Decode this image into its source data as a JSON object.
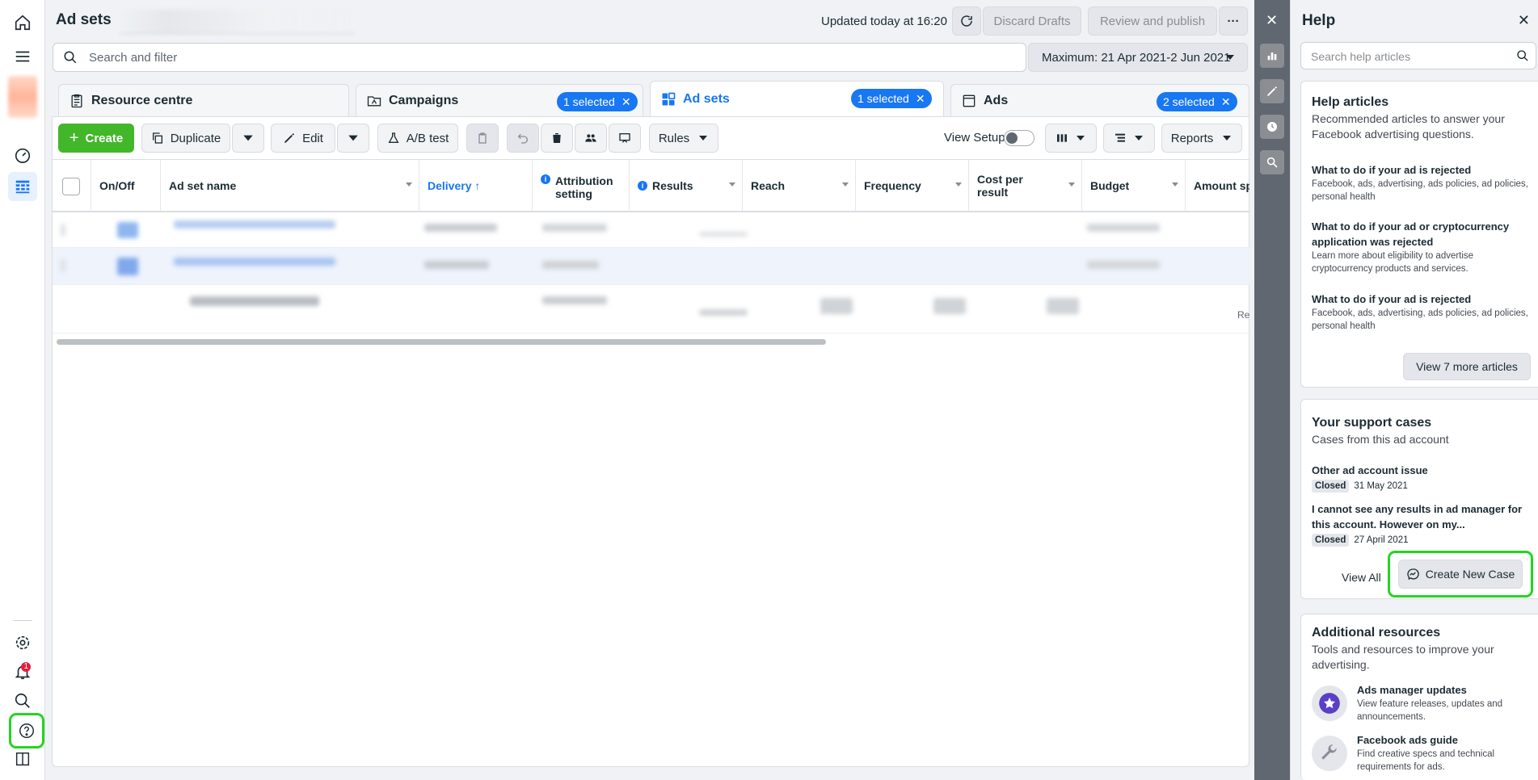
{
  "page": {
    "title": "Ad sets",
    "updated": "Updated today at 16:20"
  },
  "header": {
    "discard": "Discard Drafts",
    "review": "Review and publish",
    "more": "···"
  },
  "search": {
    "placeholder": "Search and filter"
  },
  "date_range": "Maximum: 21 Apr 2021-2 Jun 2021",
  "tabs": [
    {
      "label": "Resource centre"
    },
    {
      "label": "Campaigns",
      "selected": "1 selected"
    },
    {
      "label": "Ad sets",
      "selected": "1 selected"
    },
    {
      "label": "Ads",
      "selected": "2 selected"
    }
  ],
  "toolbar": {
    "create": "Create",
    "duplicate": "Duplicate",
    "edit": "Edit",
    "ab_test": "A/B test",
    "rules": "Rules",
    "view_setup": "View Setup",
    "reports": "Reports"
  },
  "columns": [
    "On/Off",
    "Ad set name",
    "Delivery ↑",
    "Attribution setting",
    "Results",
    "Reach",
    "Frequency",
    "Cost per result",
    "Budget",
    "Amount spe"
  ],
  "row_fragment": "Re",
  "help": {
    "title": "Help",
    "search_placeholder": "Search help articles",
    "articles_title": "Help articles",
    "articles_sub": "Recommended articles to answer your Facebook advertising questions.",
    "articles": [
      {
        "title": "What to do if your ad is rejected",
        "desc": "Facebook, ads, advertising, ads policies, ad policies, personal health"
      },
      {
        "title": "What to do if your ad or cryptocurrency application was rejected",
        "desc": "Learn more about eligibility to advertise cryptocurrency products and services."
      },
      {
        "title": "What to do if your ad is rejected",
        "desc": "Facebook, ads, advertising, ads policies, ad policies, personal health"
      }
    ],
    "view_more": "View 7 more articles",
    "cases_title": "Your support cases",
    "cases_sub": "Cases from this ad account",
    "cases": [
      {
        "title": "Other ad account issue",
        "status": "Closed",
        "date": "31 May 2021"
      },
      {
        "title": "I cannot see any results in ad manager for this account. However on my...",
        "status": "Closed",
        "date": "27 April 2021"
      }
    ],
    "view_all": "View All",
    "create_case": "Create New Case",
    "resources_title": "Additional resources",
    "resources_sub": "Tools and resources to improve your advertising.",
    "resources": [
      {
        "title": "Ads manager updates",
        "desc": "View feature releases, updates and announcements.",
        "icon": "star-icon"
      },
      {
        "title": "Facebook ads guide",
        "desc": "Find creative specs and technical requirements for ads.",
        "icon": "wrench-icon"
      }
    ]
  },
  "nav": {
    "notification_count": "1"
  },
  "colors": {
    "accent": "#1877f2",
    "create": "#42b72a",
    "highlight": "#23d523"
  }
}
